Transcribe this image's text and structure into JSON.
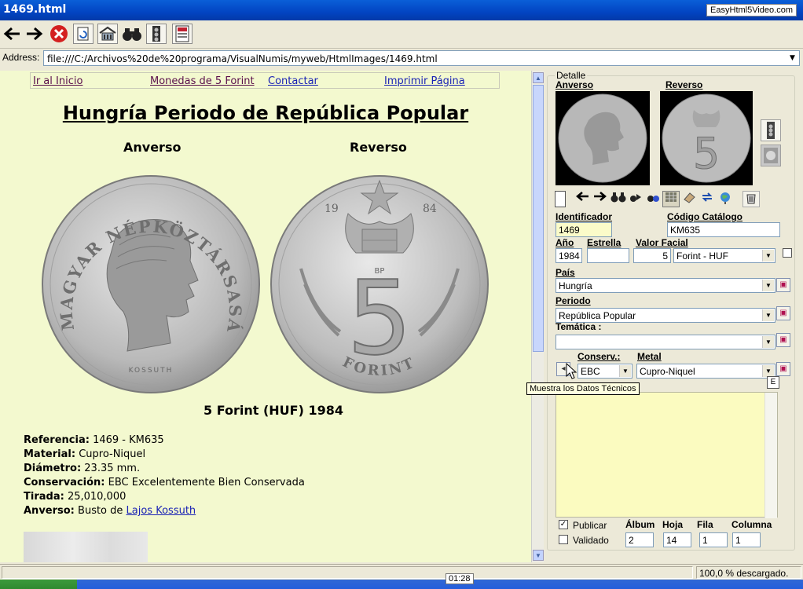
{
  "window": {
    "title": "1469.html",
    "brand": "EasyHtml5Video.com"
  },
  "address": {
    "label": "Address:",
    "url": "file:///C:/Archivos%20de%20programa/VisualNumis/myweb/HtmlImages/1469.html"
  },
  "nav": {
    "home": "Ir al Inicio",
    "coins": "Monedas de 5 Forint",
    "contact": "Contactar",
    "print": "Imprimir Página"
  },
  "page": {
    "title": "Hungría Periodo de República Popular",
    "obverse_heading": "Anverso",
    "reverse_heading": "Reverso",
    "coin_name": "5 Forint (HUF) 1984",
    "details": [
      {
        "label": "Referencia:",
        "value": "1469 - KM635"
      },
      {
        "label": "Material:",
        "value": "Cupro-Niquel"
      },
      {
        "label": "Diámetro:",
        "value": "23.35 mm."
      },
      {
        "label": "Conservación:",
        "value": "EBC Excelentemente Bien Conservada"
      },
      {
        "label": "Tirada:",
        "value": "25,010,000"
      },
      {
        "label": "Anverso:",
        "value": "Busto de ",
        "link": "Lajos Kossuth"
      }
    ],
    "coin_texts": {
      "obverse_legend": "MAGYAR NÉPKÖZTÁRSASÁG",
      "obverse_signature": "KOSSUTH",
      "reverse_year_left": "19",
      "reverse_year_right": "84",
      "reverse_mint": "BP",
      "reverse_value": "5",
      "reverse_denomination": "FORINT"
    }
  },
  "panel": {
    "group_label": "Detalle",
    "obverse_label": "Anverso",
    "reverse_label": "Reverso",
    "identificador_label": "Identificador",
    "identificador_value": "1469",
    "catalogo_label": "Código Catálogo",
    "catalogo_value": "KM635",
    "anio_label": "Año",
    "anio_value": "1984",
    "estrella_label": "Estrella",
    "estrella_value": "",
    "valor_label": "Valor Facial",
    "valor_value": "5",
    "moneda_value": "Forint - HUF",
    "pais_label": "País",
    "pais_value": "Hungría",
    "periodo_label": "Periodo",
    "periodo_value": "República Popular",
    "tematica_label": "Temática :",
    "tematica_value": "",
    "conserv_label": "Conserv.:",
    "conserv_value": "EBC",
    "metal_label": "Metal",
    "metal_value": "Cupro-Niquel",
    "extra_button": "E",
    "tooltip": "Muestra los Datos Técnicos",
    "publicar_label": "Publicar",
    "publicar_checked": true,
    "validado_label": "Validado",
    "validado_checked": false,
    "album_label": "Álbum",
    "album_value": "2",
    "hoja_label": "Hoja",
    "hoja_value": "14",
    "fila_label": "Fila",
    "fila_value": "1",
    "columna_label": "Columna",
    "columna_value": "1"
  },
  "status": {
    "progress_text": "100,0 % descargado."
  },
  "taskbar": {
    "clock": "01:28"
  },
  "colors": {
    "page_bg": "#f3f9cf",
    "link_visited": "#5a0f4c",
    "link": "#1a23b5",
    "title_bar": "#0a5fd8"
  }
}
